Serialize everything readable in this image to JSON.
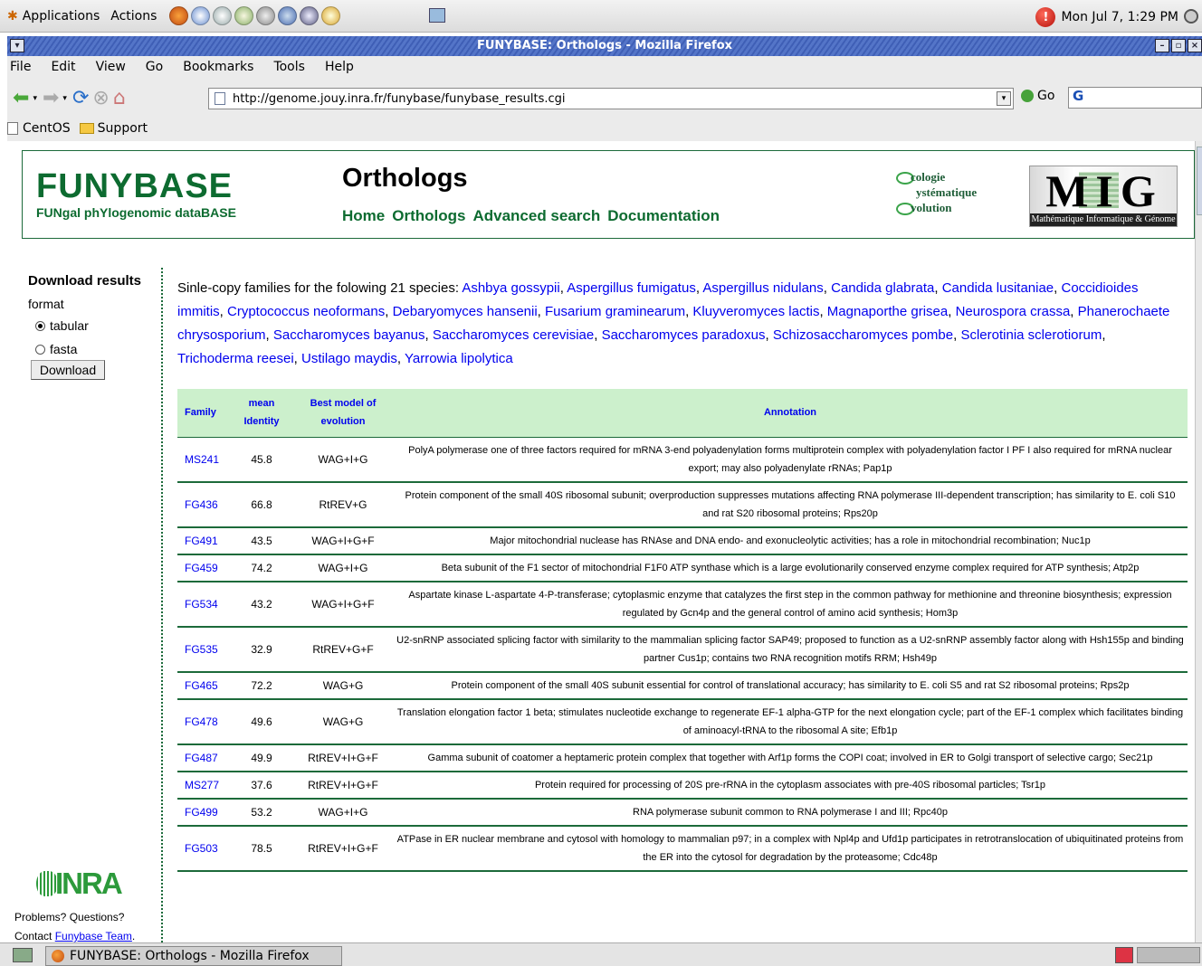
{
  "panel": {
    "applications": "Applications",
    "actions": "Actions",
    "clock": "Mon Jul  7,  1:29 PM"
  },
  "window": {
    "title": "FUNYBASE: Orthologs - Mozilla Firefox"
  },
  "menubar": {
    "items": [
      "File",
      "Edit",
      "View",
      "Go",
      "Bookmarks",
      "Tools",
      "Help"
    ]
  },
  "navbar": {
    "url": "http://genome.jouy.inra.fr/funybase/funybase_results.cgi",
    "go_label": "Go",
    "search_value": "G"
  },
  "bookmarks": {
    "items": [
      "CentOS",
      "Support"
    ]
  },
  "header": {
    "logo": "FUNYBASE",
    "logo_sub": "FUNgal phYlogenomic dataBASE",
    "page_title": "Orthologs",
    "nav": [
      "Home",
      "Orthologs",
      "Advanced search",
      "Documentation"
    ],
    "sse_lines": [
      "cologie",
      "ystématique",
      "volution"
    ],
    "mig_letters": "MIG",
    "mig_caption": "Mathématique Informatique & Génome"
  },
  "sidebar": {
    "title": "Download results",
    "format_label": "format",
    "option_tabular": "tabular",
    "option_fasta": "fasta",
    "selected": "tabular",
    "download_label": "Download",
    "inra_logo": "INRA",
    "problems": "Problems? Questions?",
    "contact_prefix": "Contact ",
    "contact_link": "Funybase Team",
    "contact_suffix": "."
  },
  "intro": {
    "prefix": "Sinle-copy families for the folowing 21 species: ",
    "species": [
      "Ashbya gossypii",
      "Aspergillus fumigatus",
      "Aspergillus nidulans",
      "Candida glabrata",
      "Candida lusitaniae",
      "Coccidioides immitis",
      "Cryptococcus neoformans",
      "Debaryomyces hansenii",
      "Fusarium graminearum",
      "Kluyveromyces lactis",
      "Magnaporthe grisea",
      "Neurospora crassa",
      "Phanerochaete chrysosporium",
      "Saccharomyces bayanus",
      "Saccharomyces cerevisiae",
      "Saccharomyces paradoxus",
      "Schizosaccharomyces pombe",
      "Sclerotinia sclerotiorum",
      "Trichoderma reesei",
      "Ustilago maydis",
      "Yarrowia lipolytica"
    ]
  },
  "table": {
    "headers": {
      "family": "Family",
      "identity_1": "mean",
      "identity_2": "Identity",
      "model_1": "Best model of",
      "model_2": "evolution",
      "annotation": "Annotation"
    },
    "rows": [
      {
        "family": "MS241",
        "identity": "45.8",
        "model": "WAG+I+G",
        "annotation": "PolyA polymerase one of three factors required for mRNA 3-end polyadenylation forms multiprotein complex with polyadenylation factor I PF I also required for mRNA nuclear export; may also polyadenylate rRNAs; Pap1p"
      },
      {
        "family": "FG436",
        "identity": "66.8",
        "model": "RtREV+G",
        "annotation": "Protein component of the small 40S ribosomal subunit; overproduction suppresses mutations affecting RNA polymerase III-dependent transcription; has similarity to E. coli S10 and rat S20 ribosomal proteins; Rps20p"
      },
      {
        "family": "FG491",
        "identity": "43.5",
        "model": "WAG+I+G+F",
        "annotation": "Major mitochondrial nuclease has RNAse and DNA endo- and exonucleolytic activities; has a role in mitochondrial recombination; Nuc1p"
      },
      {
        "family": "FG459",
        "identity": "74.2",
        "model": "WAG+I+G",
        "annotation": "Beta subunit of the F1 sector of mitochondrial F1F0 ATP synthase which is a large evolutionarily conserved enzyme complex required for ATP synthesis; Atp2p"
      },
      {
        "family": "FG534",
        "identity": "43.2",
        "model": "WAG+I+G+F",
        "annotation": "Aspartate kinase L-aspartate 4-P-transferase; cytoplasmic enzyme that catalyzes the first step in the common pathway for methionine and threonine biosynthesis; expression regulated by Gcn4p and the general control of amino acid synthesis; Hom3p"
      },
      {
        "family": "FG535",
        "identity": "32.9",
        "model": "RtREV+G+F",
        "annotation": "U2-snRNP associated splicing factor with similarity to the mammalian splicing factor SAP49; proposed to function as a U2-snRNP assembly factor along with Hsh155p and binding partner Cus1p; contains two RNA recognition motifs RRM; Hsh49p"
      },
      {
        "family": "FG465",
        "identity": "72.2",
        "model": "WAG+G",
        "annotation": "Protein component of the small 40S subunit essential for control of translational accuracy; has similarity to E. coli S5 and rat S2 ribosomal proteins; Rps2p"
      },
      {
        "family": "FG478",
        "identity": "49.6",
        "model": "WAG+G",
        "annotation": "Translation elongation factor 1 beta; stimulates nucleotide exchange to regenerate EF-1 alpha-GTP for the next elongation cycle; part of the EF-1 complex which facilitates binding of aminoacyl-tRNA to the ribosomal A site; Efb1p"
      },
      {
        "family": "FG487",
        "identity": "49.9",
        "model": "RtREV+I+G+F",
        "annotation": "Gamma subunit of coatomer a heptameric protein complex that together with Arf1p forms the COPI coat; involved in ER to Golgi transport of selective cargo; Sec21p"
      },
      {
        "family": "MS277",
        "identity": "37.6",
        "model": "RtREV+I+G+F",
        "annotation": "Protein required for processing of 20S pre-rRNA in the cytoplasm associates with pre-40S ribosomal particles; Tsr1p"
      },
      {
        "family": "FG499",
        "identity": "53.2",
        "model": "WAG+I+G",
        "annotation": "RNA polymerase subunit common to RNA polymerase I and III; Rpc40p"
      },
      {
        "family": "FG503",
        "identity": "78.5",
        "model": "RtREV+I+G+F",
        "annotation": "ATPase in ER nuclear membrane and cytosol with homology to mammalian p97; in a complex with Npl4p and Ufd1p participates in retrotranslocation of ubiquitinated proteins from the ER into the cytosol for degradation by the proteasome; Cdc48p"
      }
    ]
  },
  "taskbar": {
    "task_label": "FUNYBASE: Orthologs - Mozilla Firefox"
  },
  "colors": {
    "accent_green": "#0d6b30",
    "header_row": "#ccf0cc",
    "link": "#0000ee",
    "titlebar": "#4a6bc0"
  }
}
